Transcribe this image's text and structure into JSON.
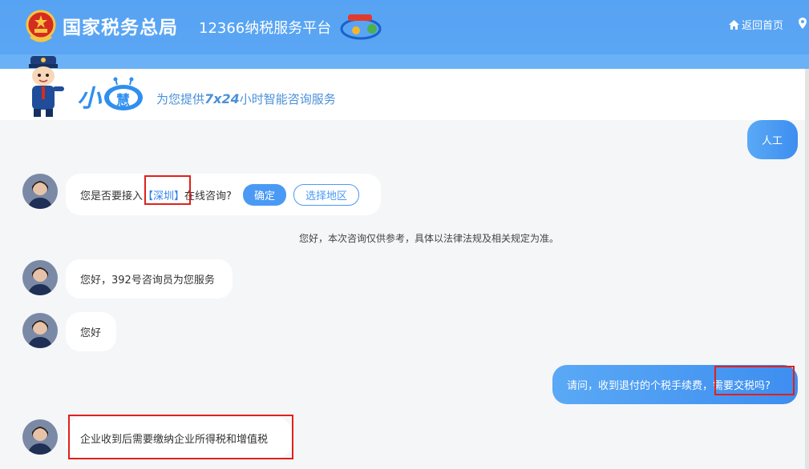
{
  "header": {
    "site_title": "国家税务总局",
    "platform": "12366纳税服务平台",
    "home_link": "返回首页"
  },
  "banner": {
    "name": "小",
    "name_badge": "慧",
    "slogan_prefix": "为您提供",
    "slogan_highlight": "7x24",
    "slogan_suffix": "小时智能咨询服务"
  },
  "chat": {
    "user_msg_1": "人工",
    "region_prompt_prefix": "您是否要接入",
    "region_city": "【深圳】",
    "region_prompt_suffix": "在线咨询?",
    "confirm_label": "确定",
    "choose_region_label": "选择地区",
    "notice": "您好，本次咨询仅供参考，具体以法律法规及相关规定为准。",
    "agent_msg_1": "您好，392号咨询员为您服务",
    "agent_msg_2": "您好",
    "user_msg_2_prefix": "请问，收到退付的个税手续费，",
    "user_msg_2_suffix": "需要交税吗?",
    "agent_msg_3": "企业收到后需要缴纳企业所得税和增值税"
  },
  "colors": {
    "header_blue": "#57a3f3",
    "user_bubble": "#3d8ef0",
    "highlight_red": "#e0201b"
  }
}
